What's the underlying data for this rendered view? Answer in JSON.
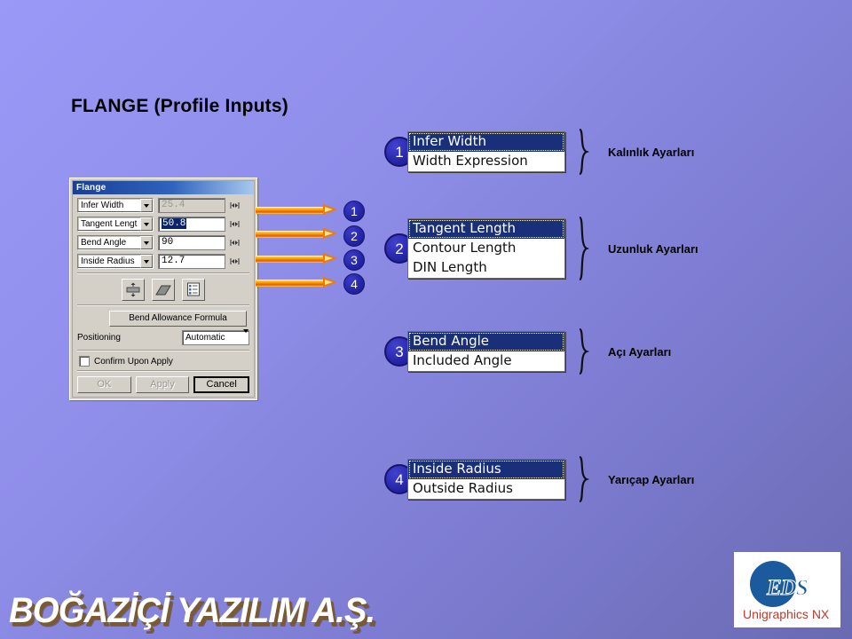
{
  "slide": {
    "title": "FLANGE (Profile Inputs)",
    "background_top": "#9a99f7",
    "background_bottom": "#6a6ab2"
  },
  "dialog": {
    "title": "Flange",
    "rows": [
      {
        "combo": "Infer Width",
        "value": "25.4",
        "state": "disabled",
        "measure_icon": "measure-icon"
      },
      {
        "combo": "Tangent Lengt",
        "value": "50.8",
        "state": "selected",
        "measure_icon": "measure-icon"
      },
      {
        "combo": "Bend Angle",
        "value": "90",
        "state": "normal",
        "measure_icon": "measure-icon"
      },
      {
        "combo": "Inside Radius",
        "value": "12.7",
        "state": "normal",
        "measure_icon": "measure-icon"
      }
    ],
    "icon_buttons": [
      {
        "name": "thickness-icon"
      },
      {
        "name": "bend-shape-icon"
      },
      {
        "name": "expression-list-icon"
      }
    ],
    "formula_button": "Bend Allowance Formula",
    "positioning_label": "Positioning",
    "positioning_value": "Automatic",
    "confirm_checkbox_label": "Confirm Upon Apply",
    "confirm_checked": false,
    "buttons": {
      "ok": "OK",
      "apply": "Apply",
      "cancel": "Cancel"
    }
  },
  "arrow_numbers": [
    "1",
    "2",
    "3",
    "4"
  ],
  "callouts": [
    {
      "number": "1",
      "items": [
        {
          "text": "Infer Width",
          "selected": true
        },
        {
          "text": "Width Expression",
          "selected": false
        }
      ],
      "label": "Kalınlık Ayarları"
    },
    {
      "number": "2",
      "items": [
        {
          "text": "Tangent Length",
          "selected": true
        },
        {
          "text": "Contour Length",
          "selected": false
        },
        {
          "text": "DIN Length",
          "selected": false
        }
      ],
      "label": "Uzunluk Ayarları"
    },
    {
      "number": "3",
      "items": [
        {
          "text": "Bend Angle",
          "selected": true
        },
        {
          "text": "Included Angle",
          "selected": false
        }
      ],
      "label": "Açı Ayarları"
    },
    {
      "number": "4",
      "items": [
        {
          "text": "Inside Radius",
          "selected": true
        },
        {
          "text": "Outside Radius",
          "selected": false
        }
      ],
      "label": "Yarıçap Ayarları"
    }
  ],
  "logo": {
    "word": "EDS",
    "subtitle": "Unigraphics NX",
    "disc_color": "#1c5a9e",
    "subtitle_color": "#c0392b"
  },
  "watermark": "BOĞAZİÇİ YAZILIM A.Ş."
}
